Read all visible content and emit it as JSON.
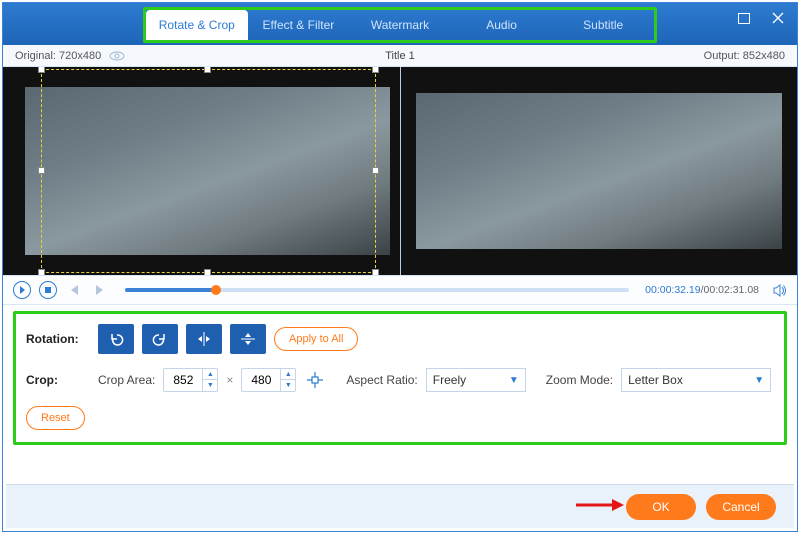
{
  "window": {
    "title": "Title 1"
  },
  "tabs": {
    "items": [
      {
        "label": "Rotate & Crop"
      },
      {
        "label": "Effect & Filter"
      },
      {
        "label": "Watermark"
      },
      {
        "label": "Audio"
      },
      {
        "label": "Subtitle"
      }
    ],
    "active_index": 0
  },
  "info": {
    "original_label": "Original: 720x480",
    "output_label": "Output: 852x480"
  },
  "playback": {
    "current": "00:00:32.19",
    "total": "/00:02:31.08",
    "position_pct": 18
  },
  "rotation": {
    "label": "Rotation:",
    "apply_all": "Apply to All"
  },
  "crop": {
    "label": "Crop:",
    "area_label": "Crop Area:",
    "width": "852",
    "height": "480",
    "aspect_label": "Aspect Ratio:",
    "aspect_value": "Freely",
    "zoom_label": "Zoom Mode:",
    "zoom_value": "Letter Box",
    "reset": "Reset"
  },
  "footer": {
    "ok": "OK",
    "cancel": "Cancel"
  },
  "colors": {
    "accent": "#2d7bd0",
    "highlight": "#2ecc1a",
    "action": "#ff7a1a"
  }
}
